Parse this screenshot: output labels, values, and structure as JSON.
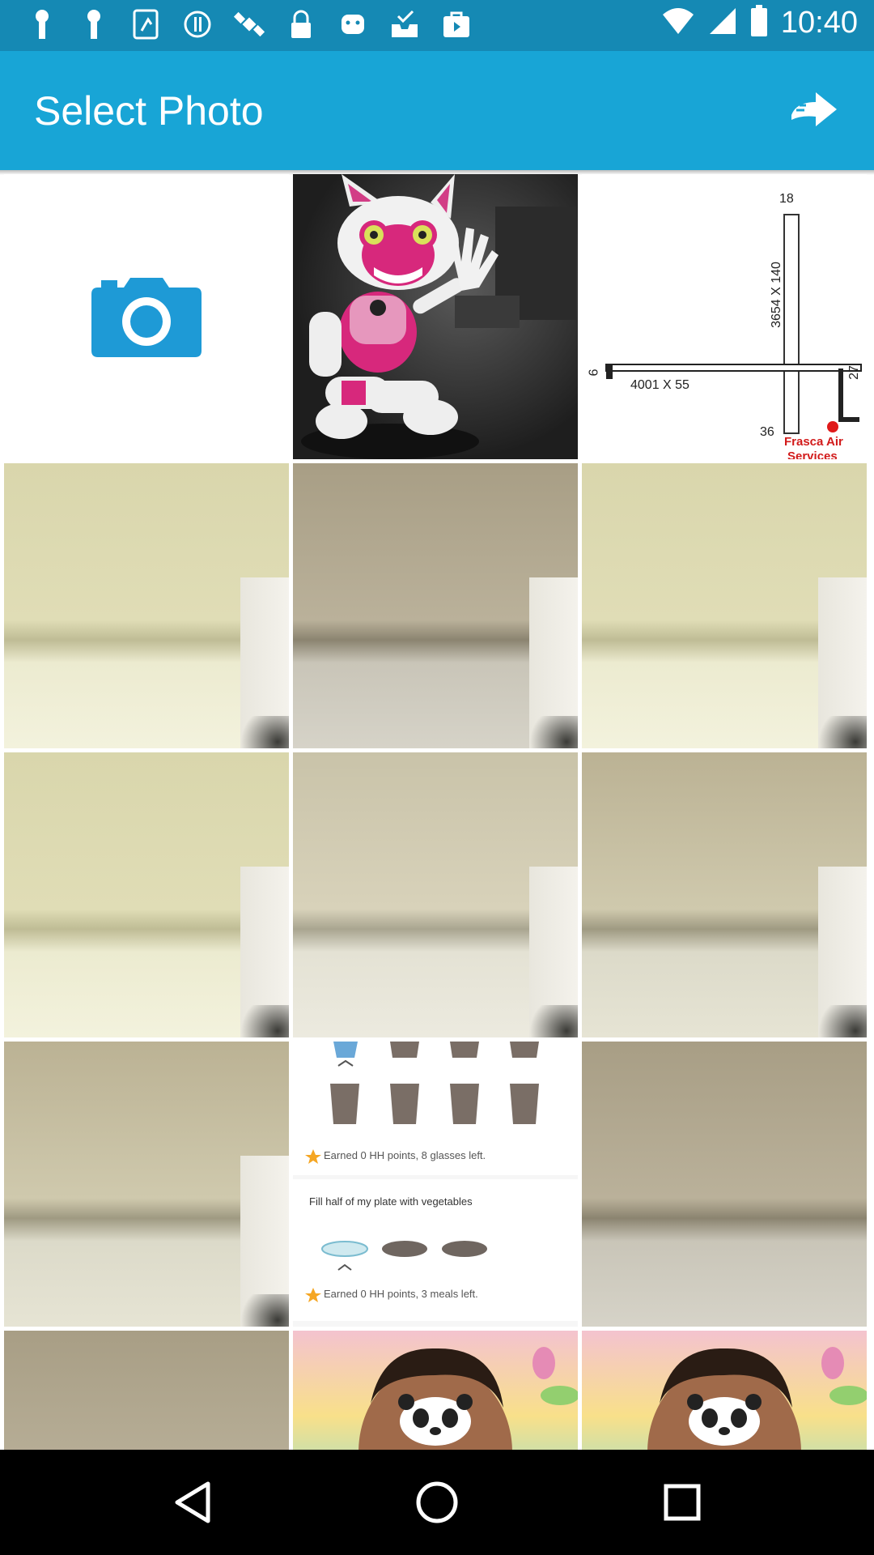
{
  "status_bar": {
    "time": "10:40",
    "icons": [
      "keyhole-icon",
      "keyhole-icon",
      "sim-icon",
      "alert-circle-icon",
      "satellite-icon",
      "lock-icon",
      "android-icon",
      "inbox-check-icon",
      "play-store-icon"
    ],
    "right_icons": [
      "wifi-icon",
      "signal-icon",
      "battery-icon"
    ]
  },
  "app_bar": {
    "title": "Select Photo",
    "next_icon": "forward-arrow-icon",
    "color": "#18a5d6"
  },
  "camera_tile": {
    "icon": "camera-icon",
    "color": "#1e9ad6"
  },
  "map_tile": {
    "runway_top": "18",
    "dims_vertical": "3654 X 140",
    "dims_horizontal": "4001 X 55",
    "end_left": "9",
    "end_right": "27",
    "end_bottom": "36",
    "brand": "Frasca Air",
    "brand_sub": "Services"
  },
  "tracker_tile": {
    "line1": "Earned 0 HH points, 8 glasses left.",
    "heading": "Fill half of my plate with vegetables",
    "line2": "Earned 0 HH points, 3 meals left."
  },
  "nav_bar": {
    "back_icon": "back-triangle-icon",
    "home_icon": "home-circle-icon",
    "recents_icon": "recents-square-icon"
  }
}
